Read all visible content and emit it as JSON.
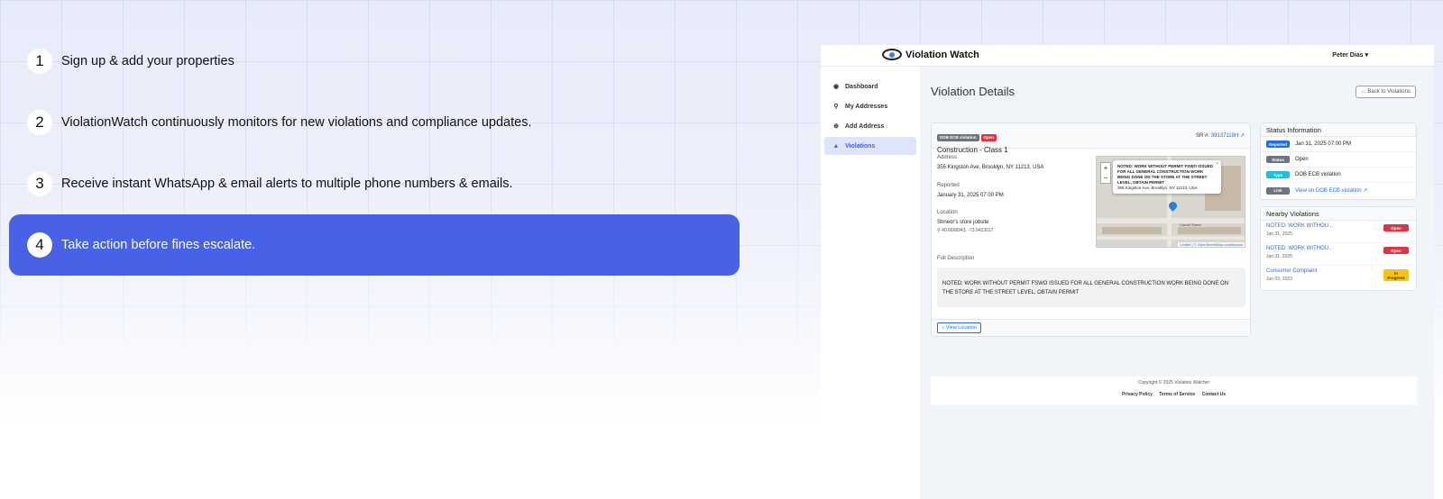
{
  "steps": [
    {
      "num": "1",
      "text": "Sign up & add your properties"
    },
    {
      "num": "2",
      "text": "ViolationWatch continuously monitors for new violations and compliance updates."
    },
    {
      "num": "3",
      "text": "Receive instant WhatsApp & email alerts to multiple phone numbers & emails."
    },
    {
      "num": "4",
      "text": "Take action before fines escalate."
    }
  ],
  "colors": {
    "accent": "#4762e6",
    "link": "#2a6edb",
    "open": "#dc3545"
  },
  "app": {
    "brand": "Violation Watch",
    "user": "Peter Dias ▾",
    "sidebar": [
      {
        "icon": "dashboard-icon",
        "label": "Dashboard"
      },
      {
        "icon": "map-pin-icon",
        "label": "My Addresses"
      },
      {
        "icon": "plus-circle-icon",
        "label": "Add Address"
      },
      {
        "icon": "warning-icon",
        "label": "Violations"
      }
    ],
    "page_title": "Violation Details",
    "back_button": "← Back to Violations",
    "violation": {
      "badge_type": "DOB ECB violation",
      "badge_status": "Open",
      "type": "Construction - Class 1",
      "sr_label": "SR #:",
      "sr_value": "39137118H",
      "address_label": "Address",
      "address": "355 Kingston Ave, Brooklyn, NY 11213, USA",
      "reported_label": "Reported",
      "reported": "January 31, 2025 07:00 PM",
      "location_label": "Location",
      "location": "Shneor's store jobsite",
      "coords": "40.6668943, -73.9423017",
      "description_label": "Full Description",
      "description": "NOTED: WORK WITHOUT PERMIT FSWO ISSUED FOR ALL GENERAL CONSTRUCTION WORK BEING DONE ON THE STORE AT THE STREET LEVEL, OBTAIN PERMIT",
      "view_location": "View Location"
    },
    "map": {
      "popup_title": "NOTED: WORK WITHOUT PERMIT FSWO ISSUED FOR ALL GENERAL CONSTRUCTION WORK BEING DONE ON THE STORE AT THE STREET LEVEL, OBTAIN PERMIT",
      "popup_address": "355 Kingston Ave, Brooklyn, NY 11213, USA",
      "street": "Carroll Street",
      "attribution": "Leaflet | © OpenStreetMap contributors",
      "zoom_in": "+",
      "zoom_out": "−"
    },
    "status_info": {
      "title": "Status Information",
      "rows": [
        {
          "badge": "Reported",
          "value": "Jan 31, 2025 07:00 PM"
        },
        {
          "badge": "Status",
          "value": "Open"
        },
        {
          "badge": "Type",
          "value": "DOB ECB violation"
        },
        {
          "badge": "Link",
          "value": "View on DOB ECB violation ↗"
        }
      ]
    },
    "nearby": {
      "title": "Nearby Violations",
      "items": [
        {
          "title": "NOTED: WORK WITHOU...",
          "date": "Jan 31, 2025",
          "badge": "Open"
        },
        {
          "title": "NOTED: WORK WITHOU...",
          "date": "Jan 31, 2025",
          "badge": "Open"
        },
        {
          "title": "Consumer Complaint",
          "date": "Jun 03, 2023",
          "badge": "In Progress"
        }
      ]
    },
    "footer": {
      "copyright": "Copyright © 2025 Violation Watcher",
      "links": [
        "Privacy Policy",
        "Terms of Service",
        "Contact Us"
      ]
    }
  }
}
